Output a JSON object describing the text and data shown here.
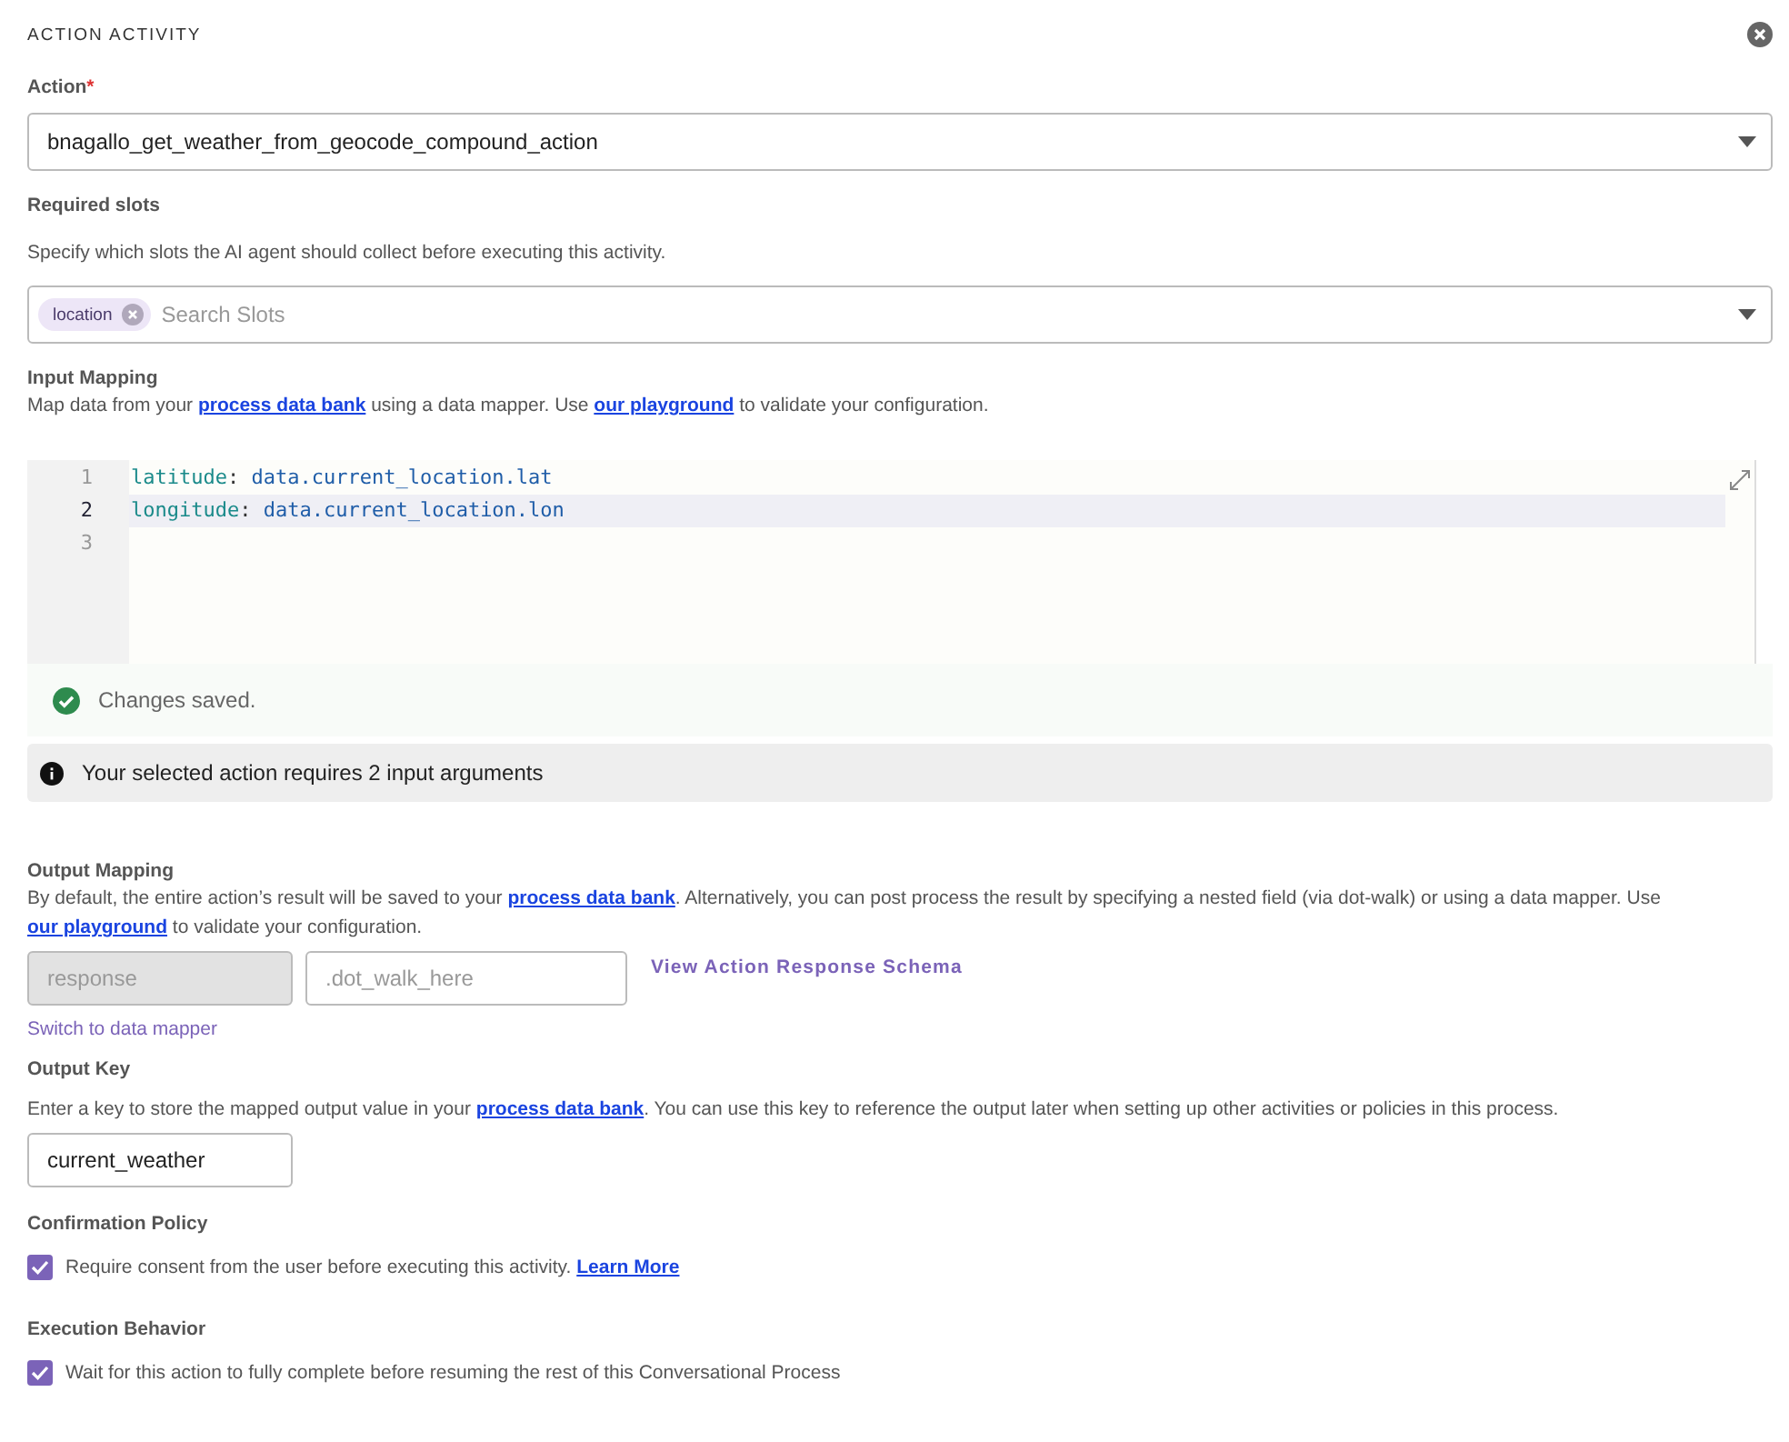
{
  "panel": {
    "title": "ACTION ACTIVITY"
  },
  "action": {
    "label": "Action",
    "required_mark": "*",
    "value": "bnagallo_get_weather_from_geocode_compound_action"
  },
  "required_slots": {
    "label": "Required slots",
    "description": "Specify which slots the AI agent should collect before executing this activity.",
    "chips": [
      "location"
    ],
    "placeholder": "Search Slots"
  },
  "input_mapping": {
    "label": "Input Mapping",
    "description": [
      {
        "kind": "text",
        "text": "Map data from your "
      },
      {
        "kind": "link",
        "text": "process data bank"
      },
      {
        "kind": "text",
        "text": " using a data mapper. Use "
      },
      {
        "kind": "link",
        "text": "our playground"
      },
      {
        "kind": "text",
        "text": " to validate your configuration."
      }
    ],
    "editor_lines": [
      {
        "number": "1",
        "key": "latitude",
        "sep": ":",
        "value": " data.current_location.lat",
        "selected": false
      },
      {
        "number": "2",
        "key": "longitude",
        "sep": ":",
        "value": " data.current_location.lon",
        "selected": true
      },
      {
        "number": "3",
        "selected": false
      }
    ],
    "status": "Changes saved.",
    "info": "Your selected action requires 2 input arguments"
  },
  "output_mapping": {
    "label": "Output Mapping",
    "description": [
      {
        "kind": "text",
        "text": "By default, the entire action’s result will be saved to your "
      },
      {
        "kind": "link",
        "text": "process data bank"
      },
      {
        "kind": "text",
        "text": ". Alternatively, you can post process the result by specifying a nested field (via dot-walk) or using a data mapper. Use "
      },
      {
        "kind": "link",
        "text": "our playground"
      },
      {
        "kind": "text",
        "text": " to validate your configuration."
      }
    ],
    "base_placeholder": "response",
    "path_placeholder": ".dot_walk_here",
    "schema_link": "View Action Response Schema",
    "switch_link": "Switch to data mapper"
  },
  "output_key": {
    "label": "Output Key",
    "description": [
      {
        "kind": "text",
        "text": "Enter a key to store the mapped output value in your "
      },
      {
        "kind": "link",
        "text": "process data bank"
      },
      {
        "kind": "text",
        "text": ". You can use this key to reference the output later when setting up other activities or policies in this process."
      }
    ],
    "value": "current_weather"
  },
  "options": [
    {
      "label": "Confirmation Policy",
      "text": [
        {
          "kind": "text",
          "text": "Require consent from the user before executing this activity. "
        },
        {
          "kind": "link",
          "text": "Learn More"
        }
      ],
      "checked": true
    },
    {
      "label": "Execution Behavior",
      "text": [
        {
          "kind": "text",
          "text": "Wait for this action to fully complete before resuming the rest of this Conversational Process"
        }
      ],
      "checked": true
    }
  ]
}
